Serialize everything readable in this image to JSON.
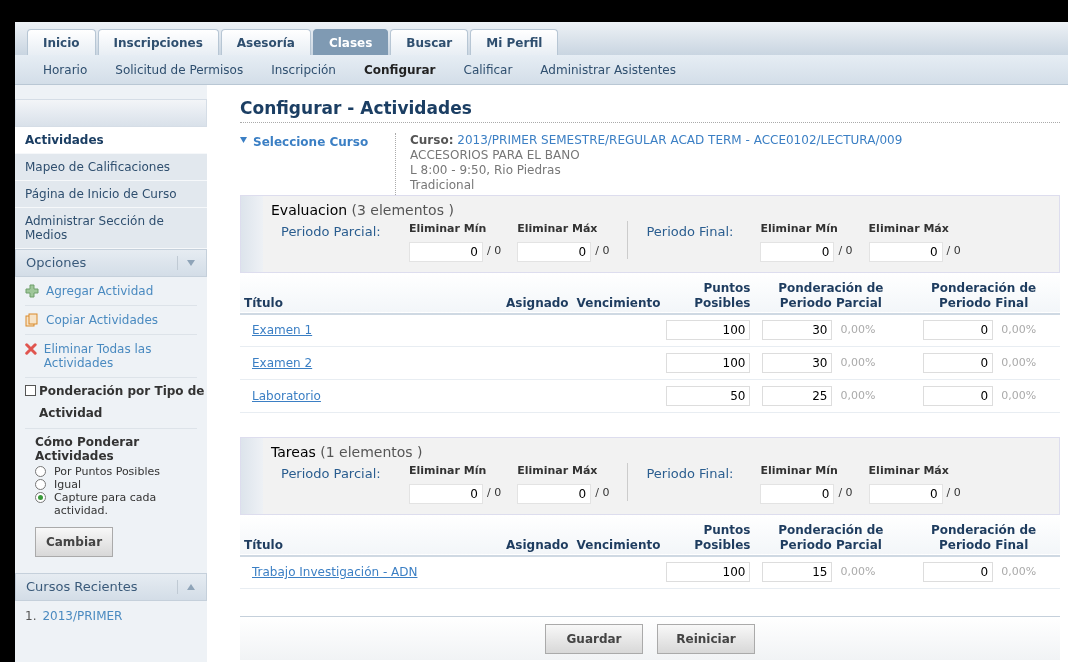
{
  "tabs": [
    {
      "label": "Inicio",
      "selected": false
    },
    {
      "label": "Inscripciones",
      "selected": false
    },
    {
      "label": "Asesoría",
      "selected": false
    },
    {
      "label": "Clases",
      "selected": true
    },
    {
      "label": "Buscar",
      "selected": false
    },
    {
      "label": "Mi Perfil",
      "selected": false
    }
  ],
  "subnav": [
    {
      "label": "Horario",
      "selected": false
    },
    {
      "label": "Solicitud de Permisos",
      "selected": false
    },
    {
      "label": "Inscripción",
      "selected": false
    },
    {
      "label": "Configurar",
      "selected": true
    },
    {
      "label": "Calificar",
      "selected": false
    },
    {
      "label": "Administrar Asistentes",
      "selected": false
    }
  ],
  "sidebar": {
    "items": [
      {
        "label": "Actividades",
        "selected": true
      },
      {
        "label": "Mapeo de Calificaciones",
        "selected": false
      },
      {
        "label": "Página de Inicio de Curso",
        "selected": false
      },
      {
        "label": "Administrar Sección de Medios",
        "selected": false
      }
    ],
    "options_header": "Opciones",
    "options": [
      {
        "kind": "add",
        "label": "Agregar Actividad"
      },
      {
        "kind": "copy",
        "label": "Copiar Actividades"
      },
      {
        "kind": "delete",
        "label": "Eliminar Todas las Actividades"
      }
    ],
    "weight_by_type": {
      "label": "Ponderación por Tipo de Actividad",
      "checked": false
    },
    "how_to_weigh": {
      "title": "Cómo Ponderar Actividades",
      "options": [
        {
          "label": "Por Puntos Posibles",
          "selected": false
        },
        {
          "label": "Igual",
          "selected": false
        },
        {
          "label": "Capture para cada actividad.",
          "selected": true
        }
      ]
    },
    "change_button": "Cambiar",
    "recent_header": "Cursos Recientes",
    "recent": [
      {
        "number": "1.",
        "label": "2013/PRIMER"
      }
    ]
  },
  "page_title": "Configurar - Actividades",
  "course": {
    "toggle": "Seleccione Curso",
    "label": "Curso:",
    "value": "2013/PRIMER SEMESTRE/REGULAR ACAD TERM - ACCE0102/LECTURA/009",
    "lines": [
      "ACCESORIOS PARA EL BANO",
      "L 8:00 - 9:50, Rio Piedras",
      "Tradicional"
    ]
  },
  "groups": [
    {
      "name": "Evaluacion",
      "count": "(3 elementos  )",
      "partial_label": "Periodo Parcial:",
      "final_label": "Periodo Final:",
      "drops": [
        {
          "label": "Eliminar Mín",
          "value": "0",
          "suffix": "/ 0"
        },
        {
          "label": "Eliminar Máx",
          "value": "0",
          "suffix": "/ 0"
        },
        {
          "label": "Eliminar Mín",
          "value": "0",
          "suffix": "/ 0"
        },
        {
          "label": "Eliminar Máx",
          "value": "0",
          "suffix": "/ 0"
        }
      ],
      "columns": [
        "Título",
        "Asignado",
        "Vencimiento",
        "Puntos Posibles",
        "Ponderación de Periodo Parcial",
        "Ponderación de Periodo Final"
      ],
      "rows": [
        {
          "title": "Examen 1",
          "points": "100",
          "partial": "30",
          "partial_pct": "0,00%",
          "final": "0",
          "final_pct": "0,00%"
        },
        {
          "title": "Examen 2",
          "points": "100",
          "partial": "30",
          "partial_pct": "0,00%",
          "final": "0",
          "final_pct": "0,00%"
        },
        {
          "title": "Laboratorio",
          "points": "50",
          "partial": "25",
          "partial_pct": "0,00%",
          "final": "0",
          "final_pct": "0,00%"
        }
      ]
    },
    {
      "name": "Tareas",
      "count": "(1 elementos  )",
      "partial_label": "Periodo Parcial:",
      "final_label": "Periodo Final:",
      "drops": [
        {
          "label": "Eliminar Mín",
          "value": "0",
          "suffix": "/ 0"
        },
        {
          "label": "Eliminar Máx",
          "value": "0",
          "suffix": "/ 0"
        },
        {
          "label": "Eliminar Mín",
          "value": "0",
          "suffix": "/ 0"
        },
        {
          "label": "Eliminar Máx",
          "value": "0",
          "suffix": "/ 0"
        }
      ],
      "columns": [
        "Título",
        "Asignado",
        "Vencimiento",
        "Puntos Posibles",
        "Ponderación de Periodo Parcial",
        "Ponderación de Periodo Final"
      ],
      "rows": [
        {
          "title": "Trabajo Investigación - ADN",
          "points": "100",
          "partial": "15",
          "partial_pct": "0,00%",
          "final": "0",
          "final_pct": "0,00%"
        }
      ]
    }
  ],
  "buttons": [
    "Guardar",
    "Reiniciar"
  ]
}
